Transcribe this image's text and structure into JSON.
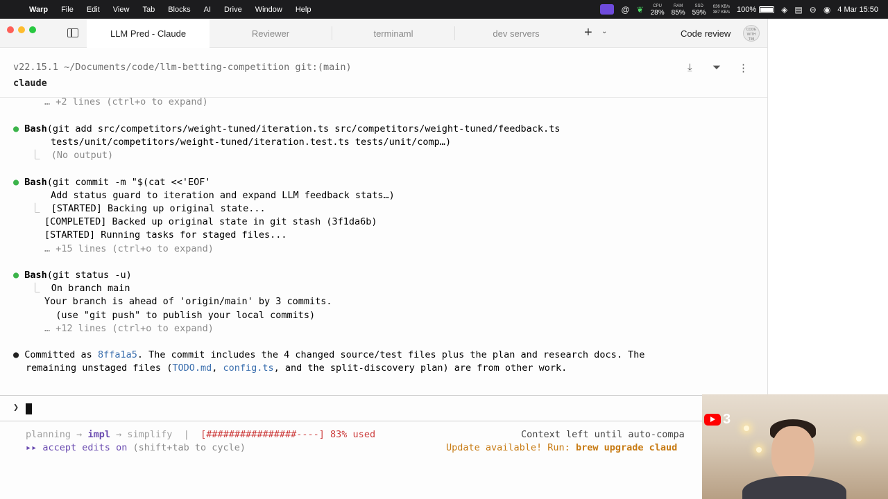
{
  "menubar": {
    "app": "Warp",
    "items": [
      "File",
      "Edit",
      "View",
      "Tab",
      "Blocks",
      "AI",
      "Drive",
      "Window",
      "Help"
    ],
    "cpu_label": "CPU",
    "cpu": "28%",
    "ram_label": "RAM",
    "ram": "85%",
    "ssd_label": "SSD",
    "ssd": "59%",
    "net_up": "636 KB/s",
    "net_down": "387 KB/s",
    "battery": "100%",
    "datetime": "4 Mar  15:50"
  },
  "tabs": [
    {
      "label": "LLM Pred - Claude",
      "active": true
    },
    {
      "label": "Reviewer"
    },
    {
      "label": "terminaml"
    },
    {
      "label": "dev servers"
    }
  ],
  "toolbar": {
    "code_review": "Code review",
    "logo_text": "CODE WITH TIM"
  },
  "header": {
    "cwd": "v22.15.1 ~/Documents/code/llm-betting-competition git:(main)",
    "command": "claude"
  },
  "output": {
    "l1": "… +2 lines (ctrl+o to expand)",
    "b1_name": "Bash",
    "b1_cmd": "(git add src/competitors/weight-tuned/iteration.ts src/competitors/weight-tuned/feedback.ts",
    "b1_cmd2": "tests/unit/competitors/weight-tuned/iteration.test.ts tests/unit/comp…)",
    "b1_out": "(No output)",
    "b2_name": "Bash",
    "b2_cmd": "(git commit -m \"$(cat <<'EOF'",
    "b2_cmd2": "Add status guard to iteration and expand LLM feedback stats…)",
    "b2_out1": "[STARTED] Backing up original state...",
    "b2_out2": "[COMPLETED] Backed up original state in git stash (3f1da6b)",
    "b2_out3": "[STARTED] Running tasks for staged files...",
    "b2_more": "… +15 lines (ctrl+o to expand)",
    "b3_name": "Bash",
    "b3_cmd": "(git status -u)",
    "b3_out1": "On branch main",
    "b3_out2": "Your branch is ahead of 'origin/main' by 3 commits.",
    "b3_out3": "  (use \"git push\" to publish your local commits)",
    "b3_more": "… +12 lines (ctrl+o to expand)",
    "msg_pre": "Committed as ",
    "msg_hash": "8ffa1a5",
    "msg_post": ". The commit includes the 4 changed source/test files plus the plan and research docs. The",
    "msg2_pre": "remaining unstaged files (",
    "msg2_f1": "TODO.md",
    "msg2_sep": ", ",
    "msg2_f2": "config.ts",
    "msg2_post": ", and the split-discovery plan) are from other work."
  },
  "prompt": {
    "symbol": "❯"
  },
  "status": {
    "planning": "planning",
    "arrow1": "→",
    "impl": "impl",
    "arrow2": "→",
    "simplify": "simplify",
    "sep": "|",
    "bar": "[################----]",
    "used": "83% used",
    "context": "Context left until auto-compa",
    "mode_icon": "▸▸",
    "accept": "accept edits on",
    "accept_hint": "(shift+tab to cycle)",
    "update_pre": "Update available! Run: ",
    "update_cmd": "brew upgrade claud"
  },
  "webcam": {
    "badge_count": "3"
  }
}
